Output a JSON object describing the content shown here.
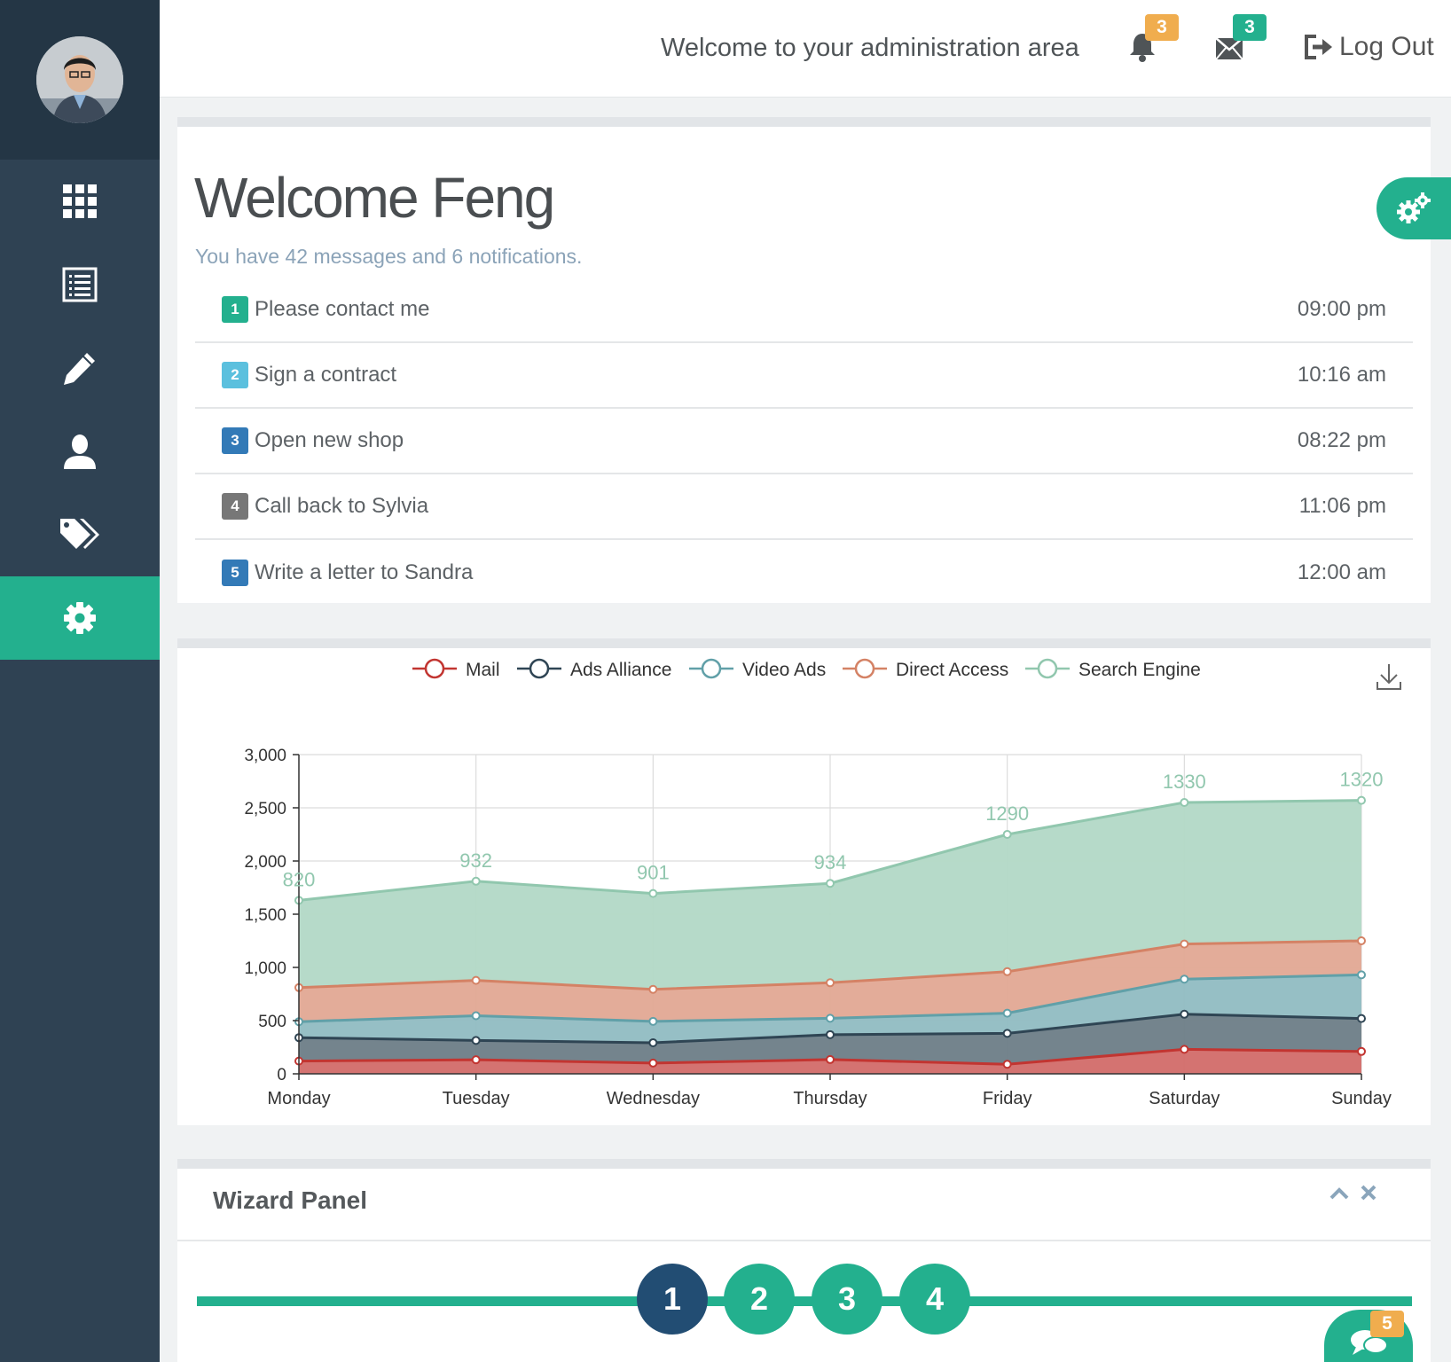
{
  "header": {
    "welcome_text": "Welcome to your administration area",
    "notifications_badge": "3",
    "messages_badge": "3",
    "logout_label": "Log Out"
  },
  "sidebar": {
    "items": [
      {
        "icon": "grid-icon",
        "active": false
      },
      {
        "icon": "list-icon",
        "active": false
      },
      {
        "icon": "pencil-icon",
        "active": false
      },
      {
        "icon": "user-icon",
        "active": false
      },
      {
        "icon": "tags-icon",
        "active": false
      },
      {
        "icon": "gear-icon",
        "active": true
      }
    ]
  },
  "welcome": {
    "title": "Welcome Feng",
    "subtitle": "You have 42 messages and 6 notifications."
  },
  "tasks": [
    {
      "num": "1",
      "label": "Please contact me",
      "time": "09:00 pm",
      "color": "#23b08e"
    },
    {
      "num": "2",
      "label": "Sign a contract",
      "time": "10:16 am",
      "color": "#5bc0de"
    },
    {
      "num": "3",
      "label": "Open new shop",
      "time": "08:22 pm",
      "color": "#337ab7"
    },
    {
      "num": "4",
      "label": "Call back to Sylvia",
      "time": "11:06 pm",
      "color": "#777777"
    },
    {
      "num": "5",
      "label": "Write a letter to Sandra",
      "time": "12:00 am",
      "color": "#337ab7"
    }
  ],
  "chart_data": {
    "type": "area",
    "stacked": true,
    "categories": [
      "Monday",
      "Tuesday",
      "Wednesday",
      "Thursday",
      "Friday",
      "Saturday",
      "Sunday"
    ],
    "ylim": [
      0,
      3000
    ],
    "yticks": [
      0,
      500,
      1000,
      1500,
      2000,
      2500,
      3000
    ],
    "ytick_labels": [
      "0",
      "500",
      "1,000",
      "1,500",
      "2,000",
      "2,500",
      "3,000"
    ],
    "grid": true,
    "legend_position": "top",
    "series": [
      {
        "name": "Mail",
        "values": [
          120,
          132,
          101,
          134,
          90,
          230,
          210
        ],
        "line": "#c23531",
        "fill": "#d26c69"
      },
      {
        "name": "Ads Alliance",
        "values": [
          220,
          182,
          191,
          234,
          290,
          330,
          310
        ],
        "line": "#2f4554",
        "fill": "#6d7d87"
      },
      {
        "name": "Video Ads",
        "values": [
          150,
          232,
          201,
          154,
          190,
          330,
          410
        ],
        "line": "#61a0a8",
        "fill": "#90bcc2"
      },
      {
        "name": "Direct Access",
        "values": [
          320,
          332,
          301,
          334,
          390,
          330,
          320
        ],
        "line": "#d48265",
        "fill": "#e1a893"
      },
      {
        "name": "Search Engine",
        "values": [
          820,
          932,
          901,
          934,
          1290,
          1330,
          1320
        ],
        "line": "#91c7ae",
        "fill": "#b2d8c6",
        "show_labels": true
      }
    ]
  },
  "wizard": {
    "title": "Wizard Panel",
    "steps": [
      "1",
      "2",
      "3",
      "4"
    ],
    "current_step": "1"
  },
  "chat": {
    "badge": "5"
  }
}
